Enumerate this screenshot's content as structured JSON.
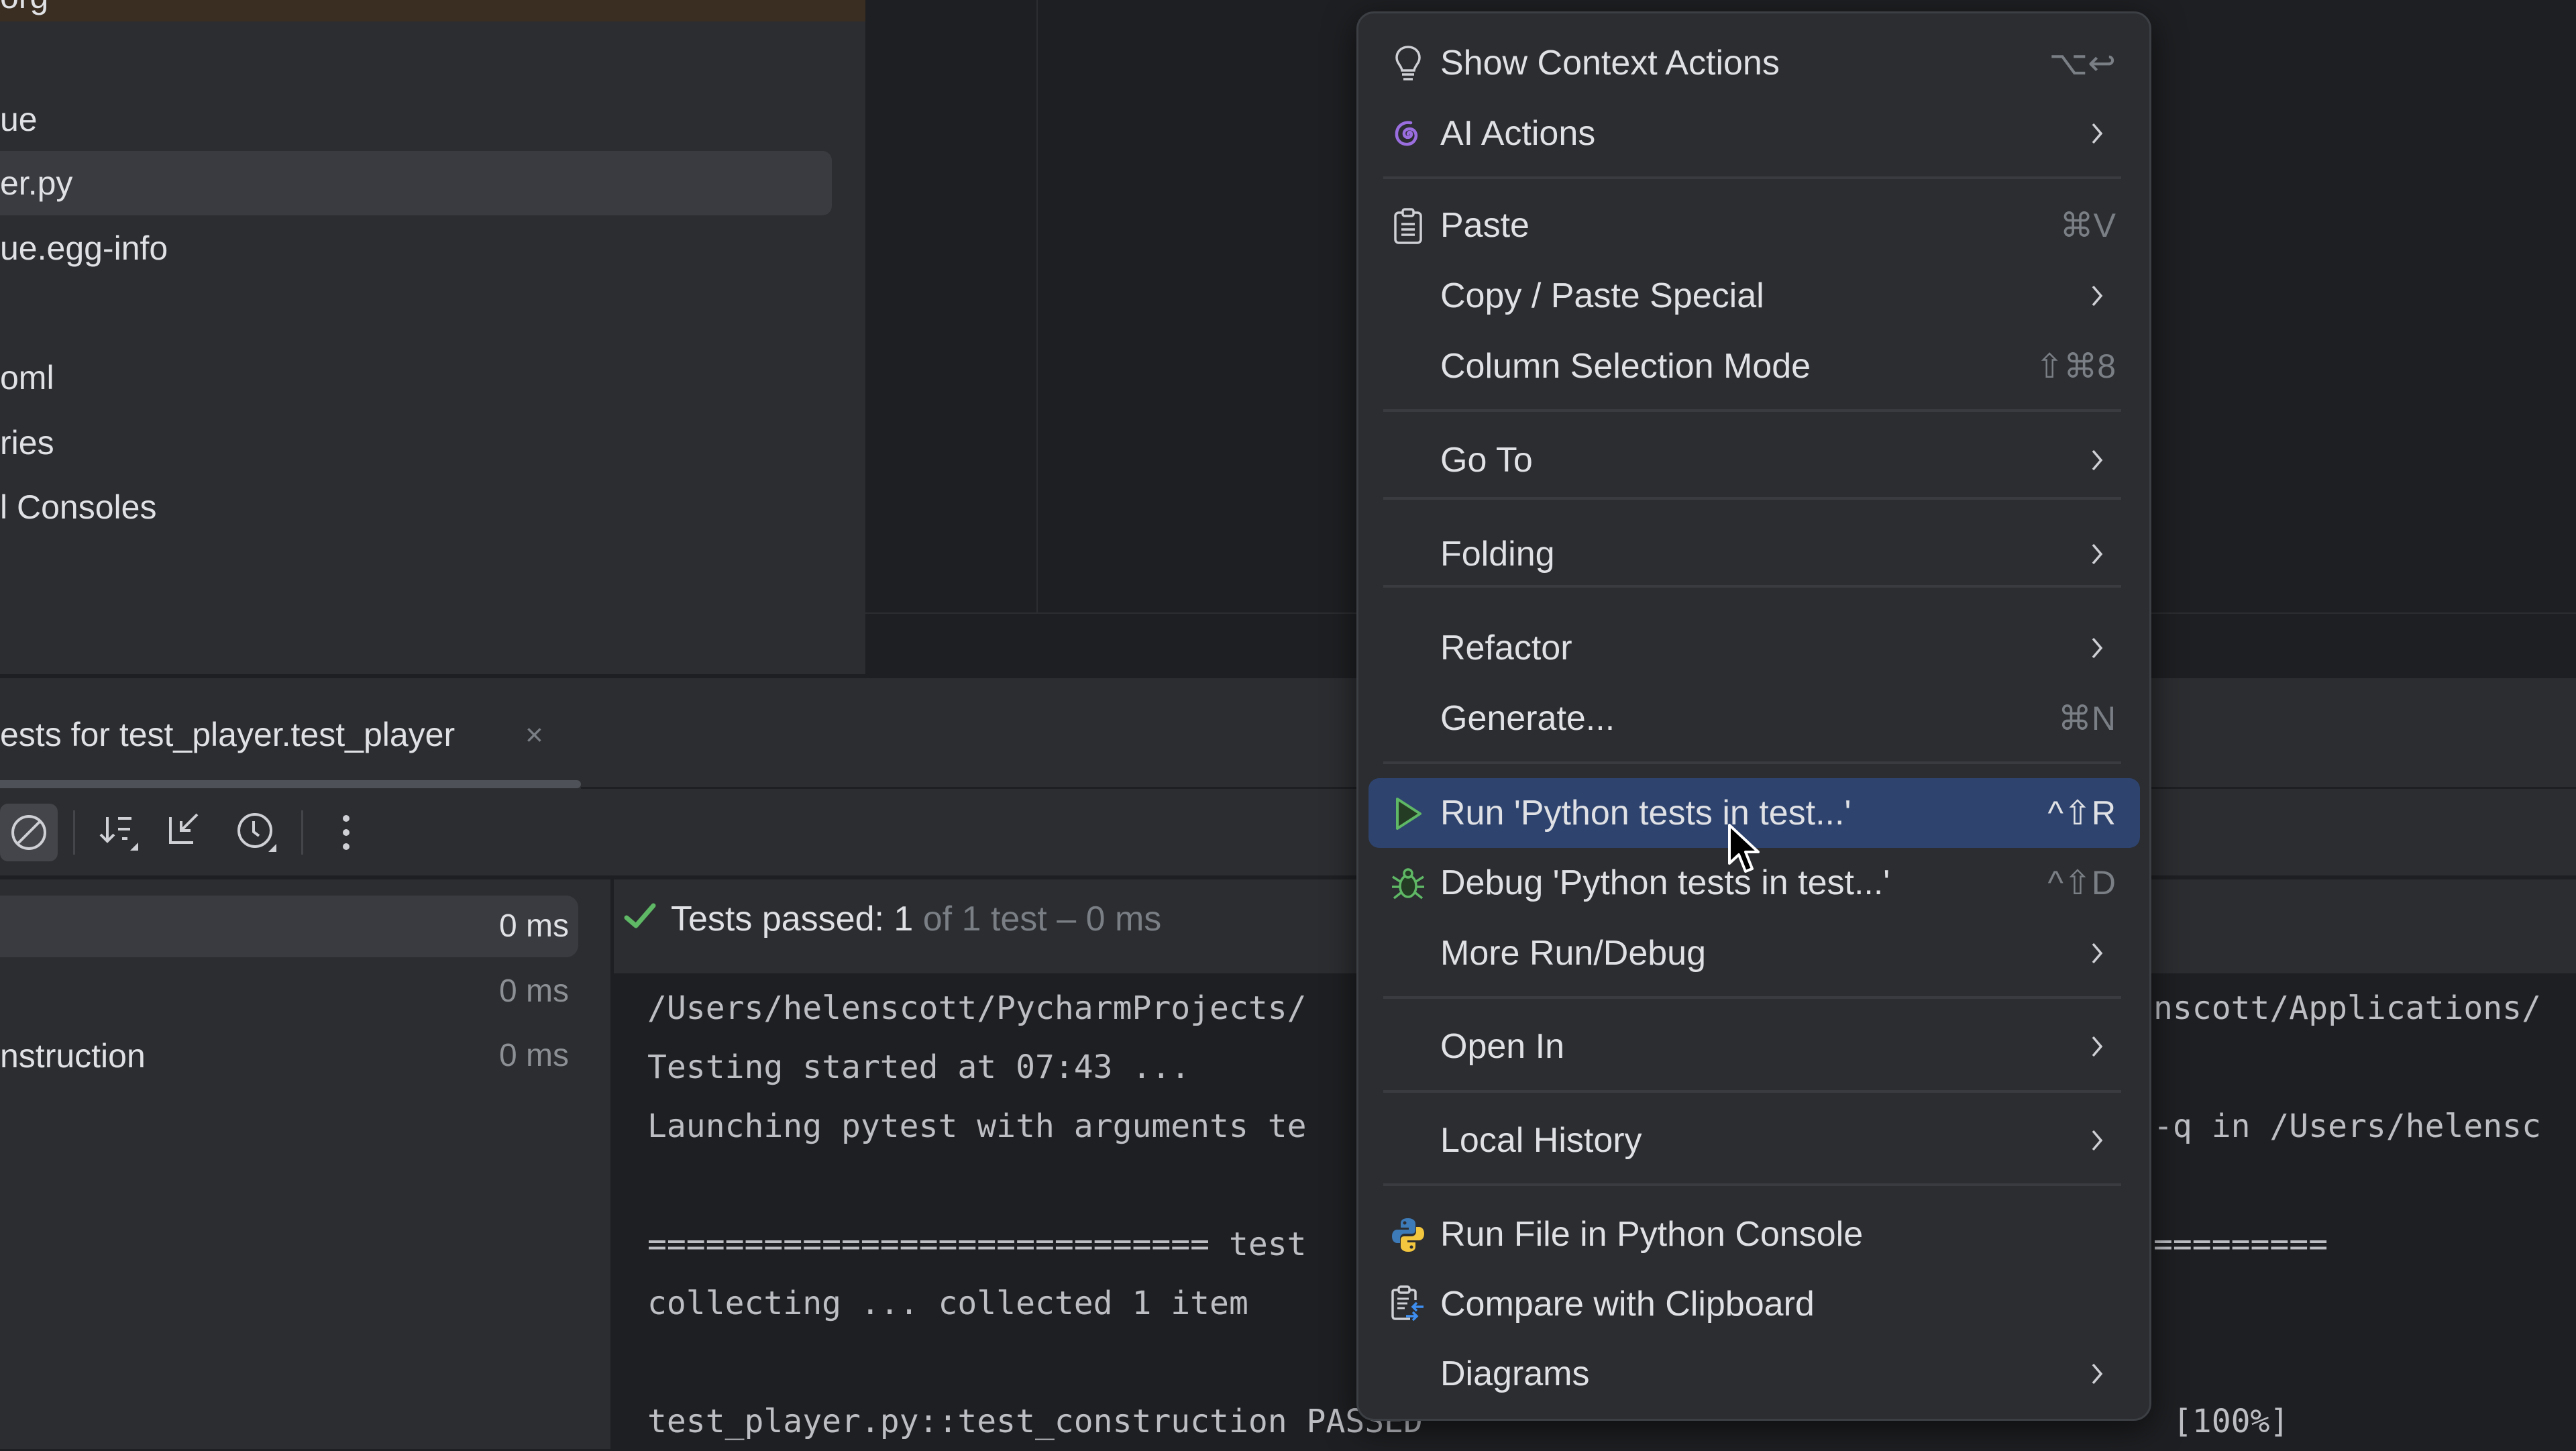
{
  "project_tree": {
    "top_strip_text": "org",
    "items": [
      {
        "label": "ue",
        "selected": false
      },
      {
        "label": "er.py",
        "selected": true
      },
      {
        "label": "ue.egg-info",
        "selected": false
      },
      {
        "label": "oml",
        "selected": false
      },
      {
        "label": "ries",
        "selected": false
      },
      {
        "label": "l Consoles",
        "selected": false
      }
    ]
  },
  "run_panel": {
    "tab_label": "ests for test_player.test_player",
    "tab_close": "×",
    "toolbar": [
      {
        "icon": "stop-disabled-icon",
        "active": true
      },
      {
        "icon": "sort-icon"
      },
      {
        "icon": "collapse-icon"
      },
      {
        "icon": "history-icon"
      },
      {
        "icon": "more-vertical-icon"
      }
    ],
    "tests": [
      {
        "name": "",
        "time": "0 ms",
        "selected": true
      },
      {
        "name": "",
        "time": "0 ms",
        "selected": false
      },
      {
        "name": "nstruction",
        "time": "0 ms",
        "selected": false
      }
    ],
    "status": {
      "passed": "Tests passed: 1",
      "rest": " of 1 test – 0 ms",
      "color": "#5fb865"
    },
    "console_lines": [
      "/Users/helenscott/PycharmProjects/",
      "Testing started at 07:43 ...",
      "Launching pytest with arguments te",
      "",
      "============================= test",
      "collecting ... collected 1 item",
      "",
      "test_player.py::test_construction PASSED"
    ],
    "console_right_lines": [
      "nscott/Applications/",
      "",
      "-q in /Users/helensc",
      "",
      "=========",
      "",
      "",
      " [100%]"
    ]
  },
  "context_menu": {
    "items": [
      {
        "label": "Show Context Actions",
        "shortcut": "⌥↩",
        "icon": "lightbulb-icon",
        "submenu": false
      },
      {
        "label": "AI Actions",
        "shortcut": "",
        "icon": "ai-spiral-icon",
        "submenu": true
      },
      {
        "separator": true
      },
      {
        "label": "Paste",
        "shortcut": "⌘V",
        "icon": "clipboard-icon",
        "submenu": false
      },
      {
        "label": "Copy / Paste Special",
        "shortcut": "",
        "icon": "",
        "submenu": true
      },
      {
        "label": "Column Selection Mode",
        "shortcut": "⇧⌘8",
        "icon": "",
        "submenu": false
      },
      {
        "separator": true
      },
      {
        "label": "Go To",
        "shortcut": "",
        "icon": "",
        "submenu": true
      },
      {
        "separator": true
      },
      {
        "label": "Folding",
        "shortcut": "",
        "icon": "",
        "submenu": true
      },
      {
        "separator": true
      },
      {
        "label": "Refactor",
        "shortcut": "",
        "icon": "",
        "submenu": true
      },
      {
        "label": "Generate...",
        "shortcut": "⌘N",
        "icon": "",
        "submenu": false
      },
      {
        "separator": true
      },
      {
        "label": "Run 'Python tests in test...'",
        "shortcut": "^⇧R",
        "icon": "run-icon",
        "submenu": false,
        "highlighted": true
      },
      {
        "label": "Debug 'Python tests in test...'",
        "shortcut": "^⇧D",
        "icon": "debug-icon",
        "submenu": false
      },
      {
        "label": "More Run/Debug",
        "shortcut": "",
        "icon": "",
        "submenu": true
      },
      {
        "separator": true
      },
      {
        "label": "Open In",
        "shortcut": "",
        "icon": "",
        "submenu": true
      },
      {
        "separator": true
      },
      {
        "label": "Local History",
        "shortcut": "",
        "icon": "",
        "submenu": true
      },
      {
        "separator": true
      },
      {
        "label": "Run File in Python Console",
        "shortcut": "",
        "icon": "python-icon",
        "submenu": false
      },
      {
        "label": "Compare with Clipboard",
        "shortcut": "",
        "icon": "compare-clipboard-icon",
        "submenu": false
      },
      {
        "label": "Diagrams",
        "shortcut": "",
        "icon": "",
        "submenu": true
      }
    ],
    "highlight_color": "#2e436e",
    "accent_run": "#5fb865",
    "accent_ai": "#9b6ee0"
  }
}
